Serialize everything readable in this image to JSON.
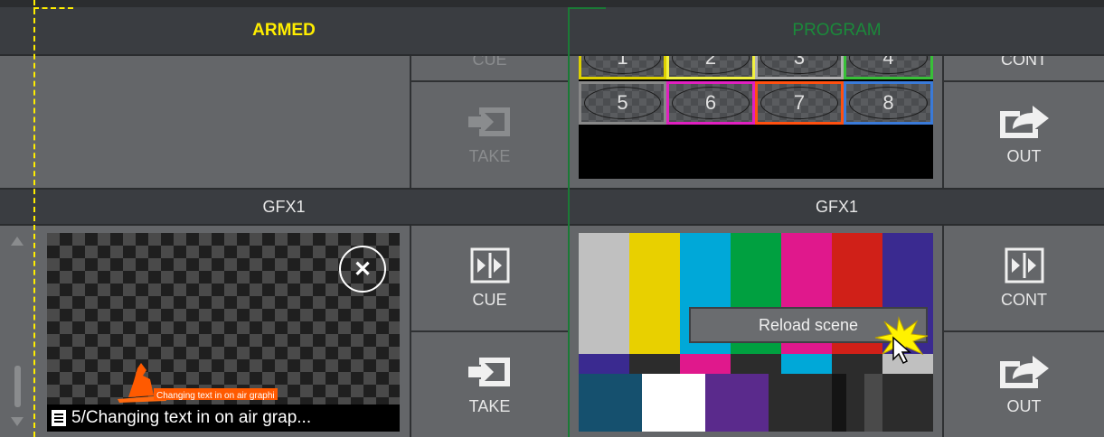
{
  "armed_header": "ARMED",
  "program_header": "PROGRAM",
  "top": {
    "armed_buttons": {
      "cue": "CUE",
      "take": "TAKE"
    },
    "program_buttons": {
      "cont": "CONT",
      "out": "OUT"
    },
    "tiles": [
      "1",
      "2",
      "3",
      "4",
      "5",
      "6",
      "7",
      "8"
    ],
    "tile_colors": [
      "#ddd000",
      "#f0f040",
      "#b0b0b0",
      "#38c038",
      "#888888",
      "#e020c0",
      "#ff5010",
      "#3a7ad8"
    ]
  },
  "bottom": {
    "armed_label": "GFX1",
    "program_label": "GFX1",
    "armed_buttons": {
      "cue": "CUE",
      "take": "TAKE"
    },
    "program_buttons": {
      "cont": "CONT",
      "out": "OUT"
    },
    "preview_caption": "5/Changing text in on air grap...",
    "preview_inner_text": "Changing text in on air graphi",
    "context_menu_item": "Reload scene"
  },
  "colors": {
    "armed": "#ffee00",
    "program": "#1a8a3a",
    "divider": "#1b7a36"
  }
}
